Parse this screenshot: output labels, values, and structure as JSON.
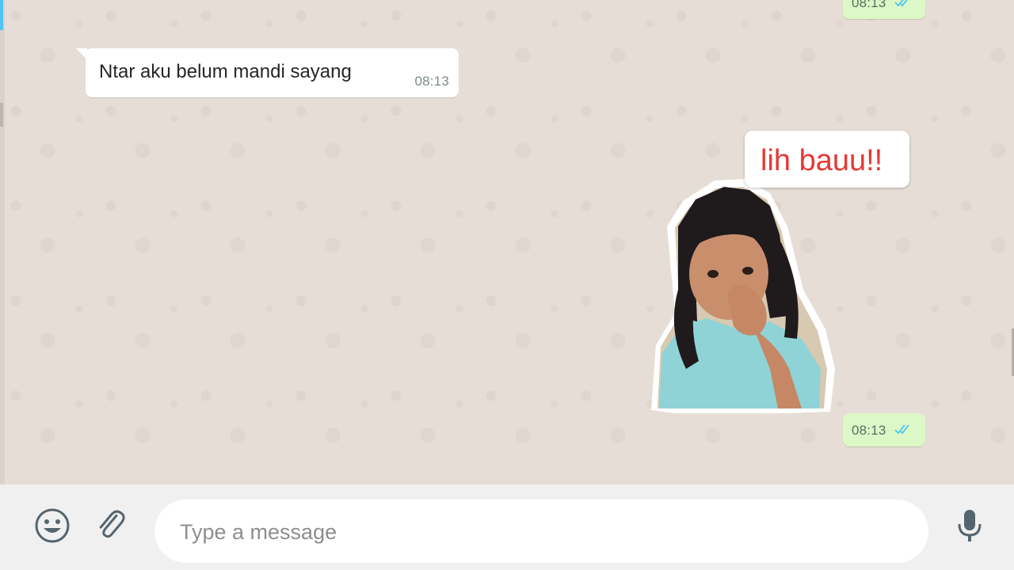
{
  "conversation": {
    "messages": [
      {
        "direction": "outgoing",
        "time": "08:13",
        "status": "read-double-tick"
      },
      {
        "direction": "incoming",
        "text": "Ntar aku belum mandi sayang",
        "time": "08:13"
      },
      {
        "direction": "outgoing",
        "type": "sticker",
        "sticker_caption": "lih bauu!!",
        "time": "08:13",
        "status": "read-double-tick"
      }
    ]
  },
  "composer": {
    "placeholder": "Type a message",
    "value": "",
    "emoji_icon": "emoji-icon",
    "attach_icon": "paperclip-icon",
    "mic_icon": "microphone-icon"
  },
  "colors": {
    "chat_background": "#e6ded6",
    "incoming_bubble": "#ffffff",
    "outgoing_bubble": "#dcf8c6",
    "read_ticks": "#4fc3f7",
    "composer_background": "#f0f0f0",
    "sticker_caption_text": "#e53935"
  }
}
